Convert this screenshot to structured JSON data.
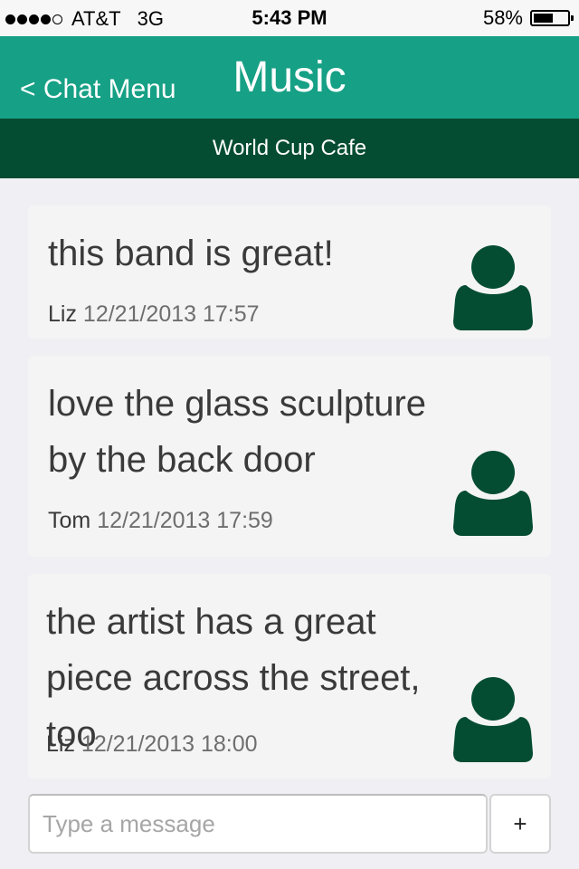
{
  "status_bar": {
    "carrier": "AT&T",
    "network": "3G",
    "time": "5:43 PM",
    "battery": "58%",
    "battery_level": 0.58,
    "signal_bars_filled": 4,
    "signal_bars_total": 5
  },
  "nav": {
    "back_label": "< Chat Menu",
    "title": "Music"
  },
  "subheader": {
    "location": "World Cup Cafe"
  },
  "messages": [
    {
      "text": "this band is great!",
      "author": "Liz",
      "timestamp": "12/21/2013 17:57",
      "avatar_icon": "user-icon"
    },
    {
      "text": "love the glass sculpture by the back door",
      "author": "Tom",
      "timestamp": "12/21/2013 17:59",
      "avatar_icon": "user-icon"
    },
    {
      "text": "the artist has a great piece across the street, too",
      "author": "Liz",
      "timestamp": "12/21/2013 18:00",
      "avatar_icon": "user-icon"
    }
  ],
  "composer": {
    "placeholder": "Type a message",
    "value": "",
    "add_label": "+"
  },
  "colors": {
    "nav_bg": "#16a085",
    "subheader_bg": "#054d32",
    "avatar": "#054d32",
    "page_bg": "#f0f0f4",
    "bubble_bg": "#f4f4f4"
  }
}
